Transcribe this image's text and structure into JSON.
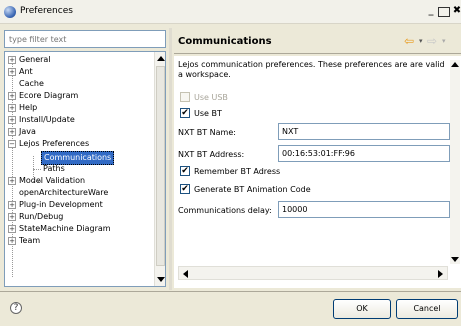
{
  "window": {
    "title": "Preferences",
    "minimize_glyph": "_",
    "maximize_glyph": "",
    "close_glyph": "✖"
  },
  "filter": {
    "placeholder": "type filter text"
  },
  "tree": {
    "items": [
      {
        "label": "General",
        "expander": "+"
      },
      {
        "label": "Ant",
        "expander": "+"
      },
      {
        "label": "Cache",
        "expander": ""
      },
      {
        "label": "Ecore Diagram",
        "expander": "+"
      },
      {
        "label": "Help",
        "expander": "+"
      },
      {
        "label": "Install/Update",
        "expander": "+"
      },
      {
        "label": "Java",
        "expander": "+"
      },
      {
        "label": "Lejos Preferences",
        "expander": "−"
      },
      {
        "label": "Communications",
        "expander": ""
      },
      {
        "label": "Paths",
        "expander": ""
      },
      {
        "label": "Model Validation",
        "expander": "+"
      },
      {
        "label": "openArchitectureWare",
        "expander": ""
      },
      {
        "label": "Plug-in Development",
        "expander": "+"
      },
      {
        "label": "Run/Debug",
        "expander": "+"
      },
      {
        "label": "StateMachine Diagram",
        "expander": "+"
      },
      {
        "label": "Team",
        "expander": "+"
      }
    ]
  },
  "page": {
    "title": "Communications",
    "back_glyph": "⇦",
    "fwd_glyph": "⇨",
    "caret_glyph": "▾",
    "description": "Lejos communication preferences. These preferences are are valid a workspace.",
    "use_usb_label": "Use USB",
    "use_bt_label": "Use BT",
    "nxt_bt_name_label": "NXT BT Name:",
    "nxt_bt_name_value": "NXT",
    "nxt_bt_address_label": "NXT BT Address:",
    "nxt_bt_address_value": "00:16:53:01:FF:96",
    "remember_bt_label": "Remember BT Adress",
    "generate_bt_label": "Generate BT Animation Code",
    "comm_delay_label": "Communications delay:",
    "comm_delay_value": "10000",
    "check_glyph": "✔"
  },
  "footer": {
    "help_glyph": "?",
    "ok_label": "OK",
    "cancel_label": "Cancel"
  }
}
